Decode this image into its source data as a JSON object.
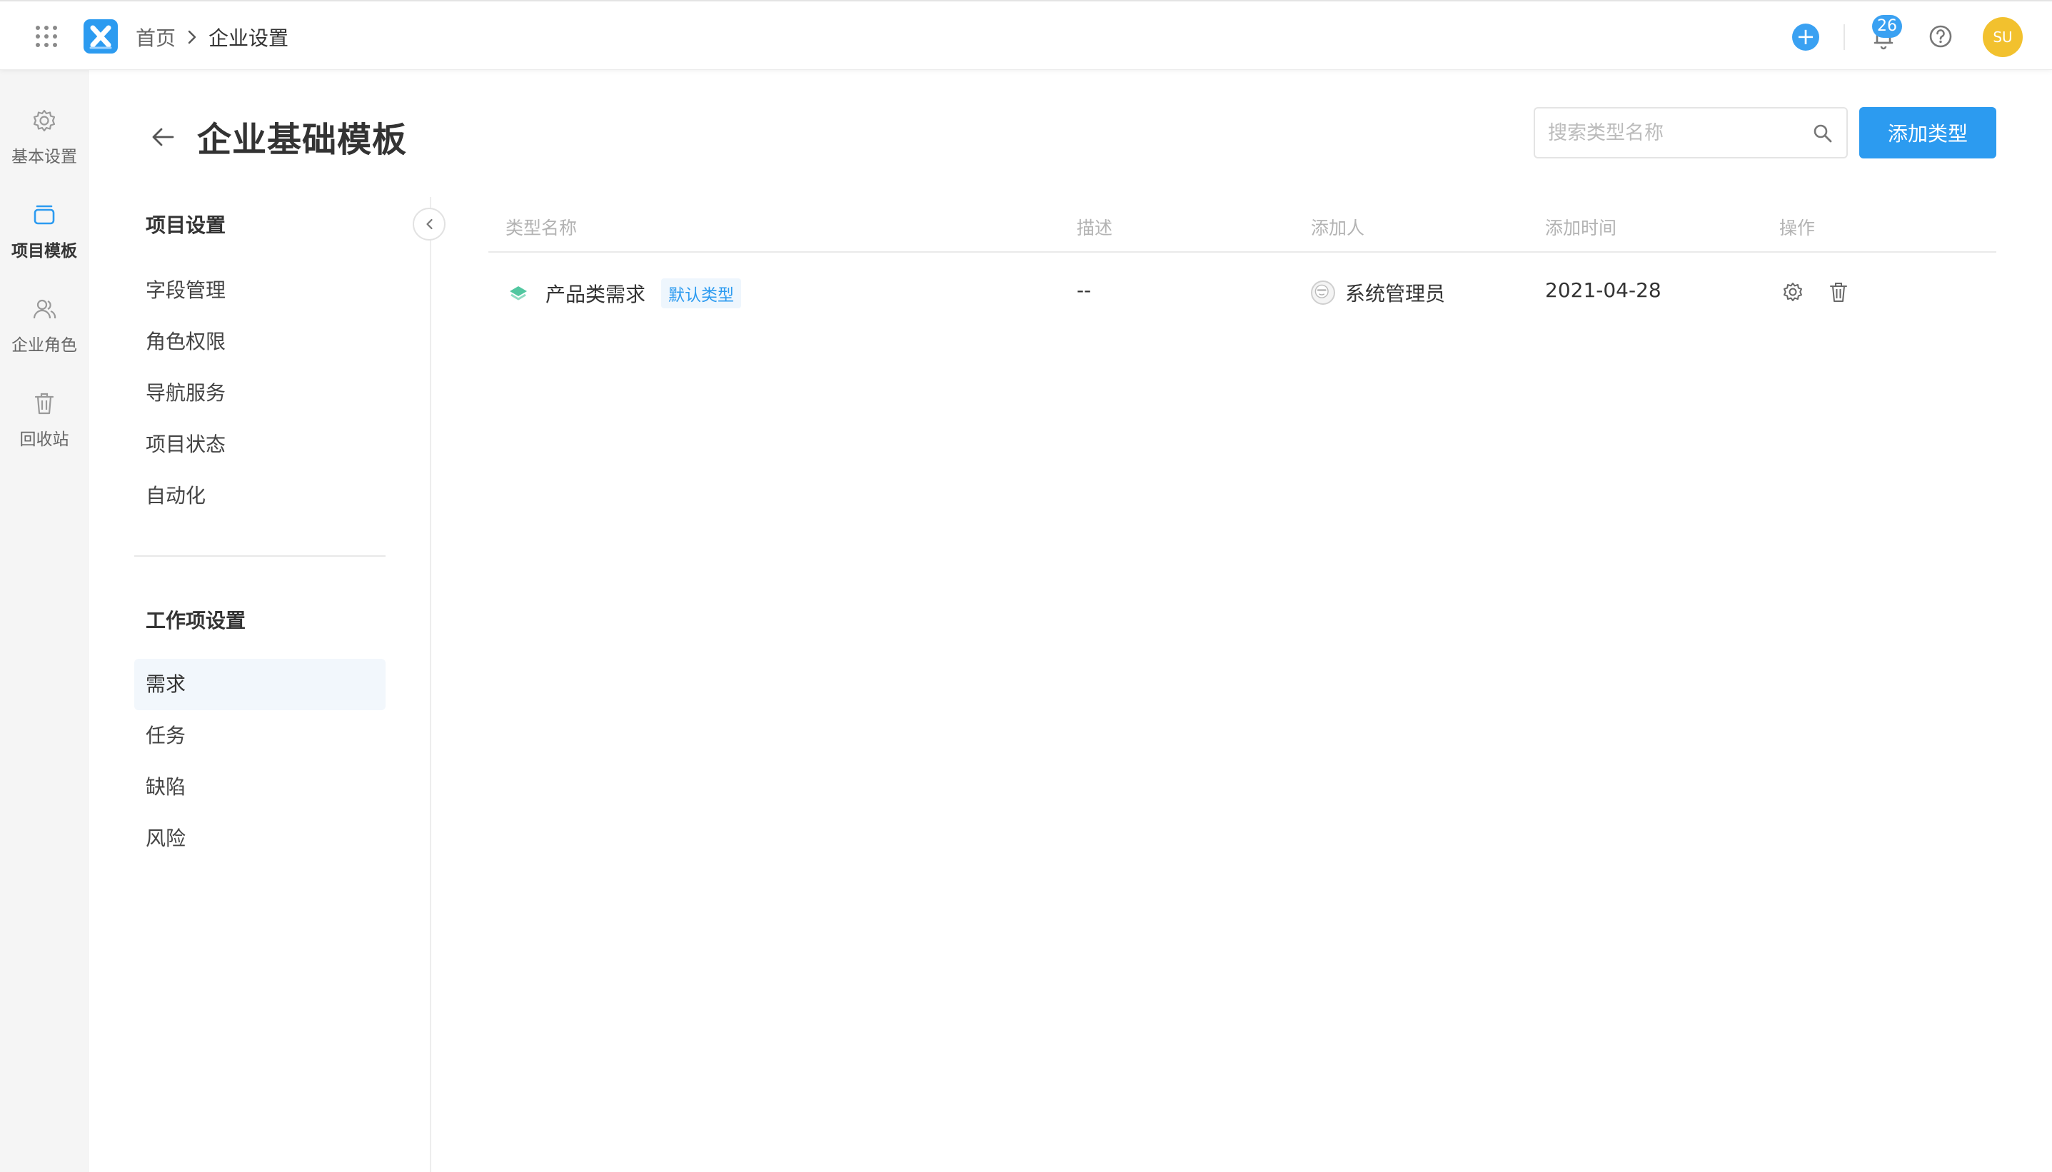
{
  "header": {
    "breadcrumb": {
      "home": "首页",
      "current": "企业设置"
    },
    "notification_count": "26",
    "user_initials": "SU",
    "accent_color": "#2c9bf0",
    "avatar_color": "#f2c12e"
  },
  "rail": {
    "items": [
      {
        "label": "基本设置",
        "icon": "gear-icon"
      },
      {
        "label": "项目模板",
        "icon": "template-icon",
        "active": true
      },
      {
        "label": "企业角色",
        "icon": "users-icon"
      },
      {
        "label": "回收站",
        "icon": "trash-icon"
      }
    ]
  },
  "page": {
    "title": "企业基础模板",
    "search_placeholder": "搜索类型名称",
    "add_button": "添加类型"
  },
  "nav": {
    "project_settings": {
      "title": "项目设置",
      "items": [
        "字段管理",
        "角色权限",
        "导航服务",
        "项目状态",
        "自动化"
      ]
    },
    "work_item_settings": {
      "title": "工作项设置",
      "items": [
        "需求",
        "任务",
        "缺陷",
        "风险"
      ],
      "active": "需求"
    }
  },
  "table": {
    "columns": [
      "类型名称",
      "描述",
      "添加人",
      "添加时间",
      "操作"
    ],
    "rows": [
      {
        "name": "产品类需求",
        "tag": "默认类型",
        "description": "--",
        "added_by": "系统管理员",
        "added_time": "2021-04-28"
      }
    ]
  }
}
